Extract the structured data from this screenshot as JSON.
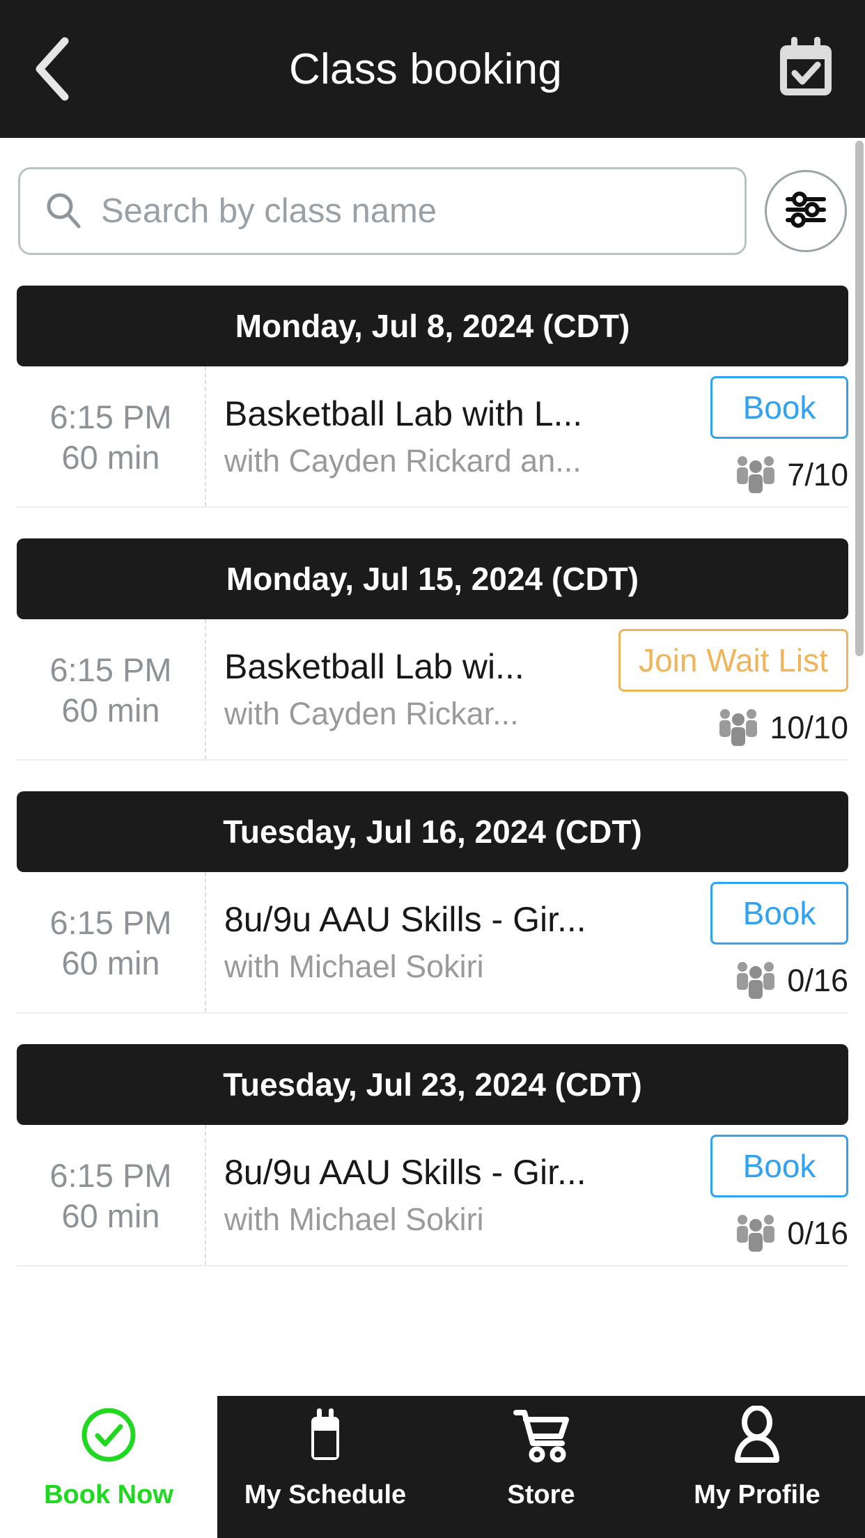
{
  "header": {
    "title": "Class booking",
    "back_icon": "chevron-left-icon",
    "action_icon": "calendar-check-icon"
  },
  "search": {
    "placeholder": "Search by class name",
    "value": "",
    "search_icon": "search-icon",
    "filter_icon": "sliders-filter-icon"
  },
  "sections": [
    {
      "date_label": "Monday, Jul 8, 2024 (CDT)",
      "classes": [
        {
          "time": "6:15  PM",
          "duration": "60 min",
          "name": "Basketball Lab with L...",
          "instructor": "with Cayden Rickard an...",
          "action_label": "Book",
          "action_type": "book",
          "capacity": "7/10",
          "capacity_icon": "people-group-icon"
        }
      ]
    },
    {
      "date_label": "Monday, Jul 15, 2024 (CDT)",
      "classes": [
        {
          "time": "6:15  PM",
          "duration": "60 min",
          "name": "Basketball Lab wi...",
          "instructor": "with Cayden Rickar...",
          "action_label": "Join Wait List",
          "action_type": "waitlist",
          "capacity": "10/10",
          "capacity_icon": "people-group-icon"
        }
      ]
    },
    {
      "date_label": "Tuesday, Jul 16, 2024 (CDT)",
      "classes": [
        {
          "time": "6:15  PM",
          "duration": "60 min",
          "name": "8u/9u AAU Skills - Gir...",
          "instructor": "with Michael Sokiri",
          "action_label": "Book",
          "action_type": "book",
          "capacity": "0/16",
          "capacity_icon": "people-group-icon"
        }
      ]
    },
    {
      "date_label": "Tuesday, Jul 23, 2024 (CDT)",
      "classes": [
        {
          "time": "6:15  PM",
          "duration": "60 min",
          "name": "8u/9u AAU Skills - Gir...",
          "instructor": "with Michael Sokiri",
          "action_label": "Book",
          "action_type": "book",
          "capacity": "0/16",
          "capacity_icon": "people-group-icon"
        }
      ]
    }
  ],
  "tabbar": {
    "items": [
      {
        "label": "Book Now",
        "icon": "check-circle-icon",
        "active": true
      },
      {
        "label": "My Schedule",
        "icon": "calendar-icon",
        "active": false
      },
      {
        "label": "Store",
        "icon": "shopping-cart-icon",
        "active": false
      },
      {
        "label": "My Profile",
        "icon": "person-icon",
        "active": false
      }
    ]
  },
  "colors": {
    "header_bg": "#1b1b1b",
    "book_accent": "#30a2f2",
    "waitlist_accent": "#f0b45a",
    "active_tab": "#21d821",
    "muted_text": "#8d9297"
  }
}
